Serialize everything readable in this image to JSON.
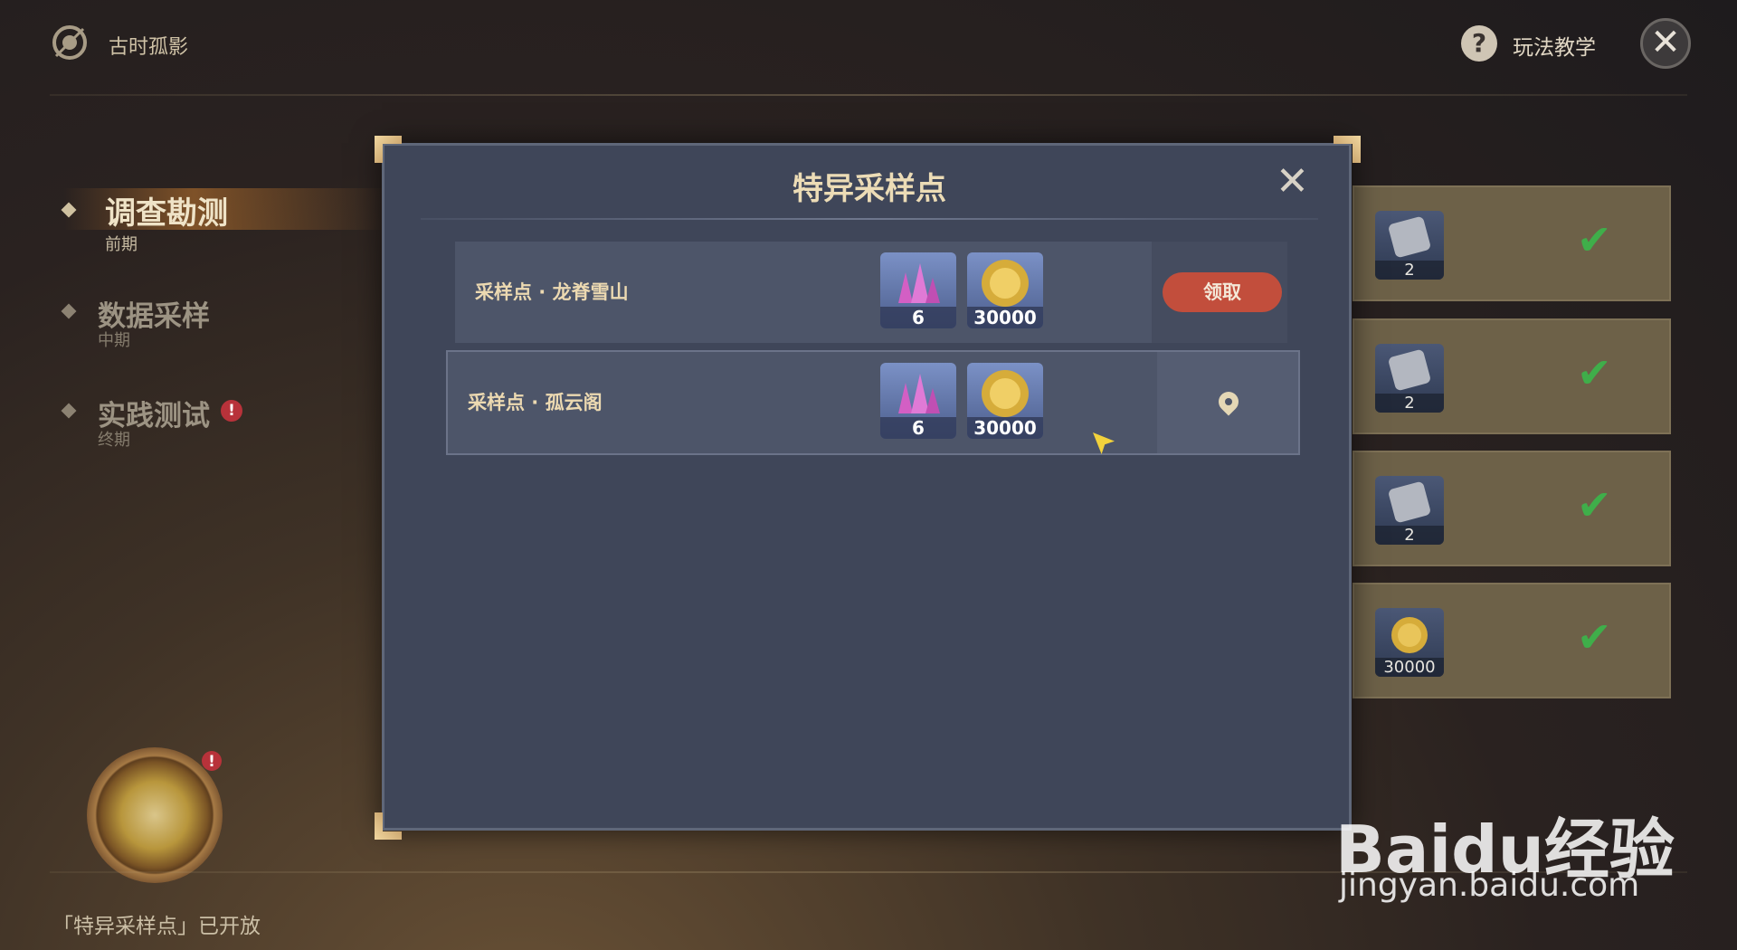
{
  "header": {
    "title": "古时孤影",
    "help_label": "玩法教学"
  },
  "nav": {
    "items": [
      {
        "label": "调查勘测",
        "sub": "前期"
      },
      {
        "label": "数据采样",
        "sub": "中期"
      },
      {
        "label": "实践测试",
        "sub": "终期"
      }
    ]
  },
  "notice": "「特异采样点」已开放",
  "rewards": [
    {
      "count": "2"
    },
    {
      "count": "2"
    },
    {
      "count": "2"
    },
    {
      "count": "30000"
    }
  ],
  "dialog": {
    "title": "特异采样点",
    "rows": [
      {
        "label": "采样点 · 龙脊雪山",
        "items": [
          {
            "count": "6",
            "icon": "crystal-icon"
          },
          {
            "count": "30000",
            "icon": "mora-coin-icon"
          }
        ],
        "action": "领取"
      },
      {
        "label": "采样点 · 孤云阁",
        "items": [
          {
            "count": "6",
            "icon": "crystal-icon"
          },
          {
            "count": "30000",
            "icon": "mora-coin-icon"
          }
        ],
        "action": "locate"
      }
    ]
  },
  "watermark": {
    "brand": "Baidu经验",
    "url": "jingyan.baidu.com"
  },
  "colors": {
    "accent_claim": "#c24e3c",
    "check": "#3fae4a",
    "dialog_bg": "#3f4659"
  }
}
